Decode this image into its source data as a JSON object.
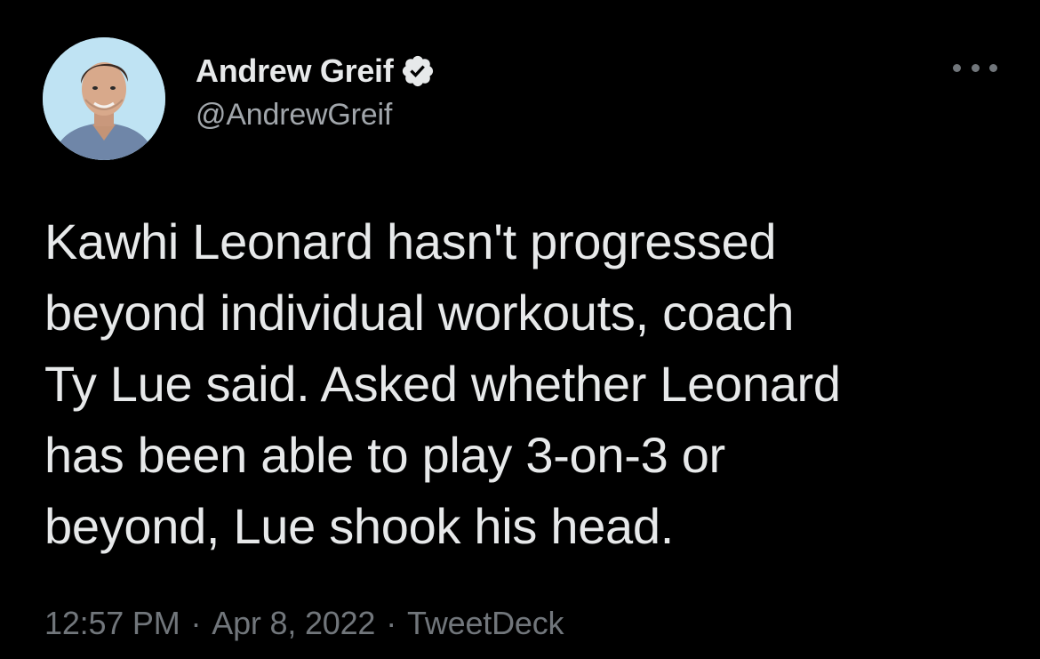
{
  "tweet": {
    "author": {
      "display_name": "Andrew Greif",
      "handle": "@AndrewGreif",
      "verified": true,
      "avatar_icon": "profile-photo"
    },
    "more_icon": "ellipsis-icon",
    "text": "Kawhi Leonard hasn't progressed\nbeyond individual workouts, coach\nTy Lue said. Asked whether Leonard\nhas been able to play 3-on-3 or\nbeyond, Lue shook his head.",
    "meta": {
      "time": "12:57 PM",
      "separator": "·",
      "date": "Apr 8, 2022",
      "source": "TweetDeck"
    }
  },
  "colors": {
    "background": "#000000",
    "primary_text": "#e7e9ea",
    "secondary_text": "#71767b",
    "verified_badge": "#e7e9ea"
  }
}
